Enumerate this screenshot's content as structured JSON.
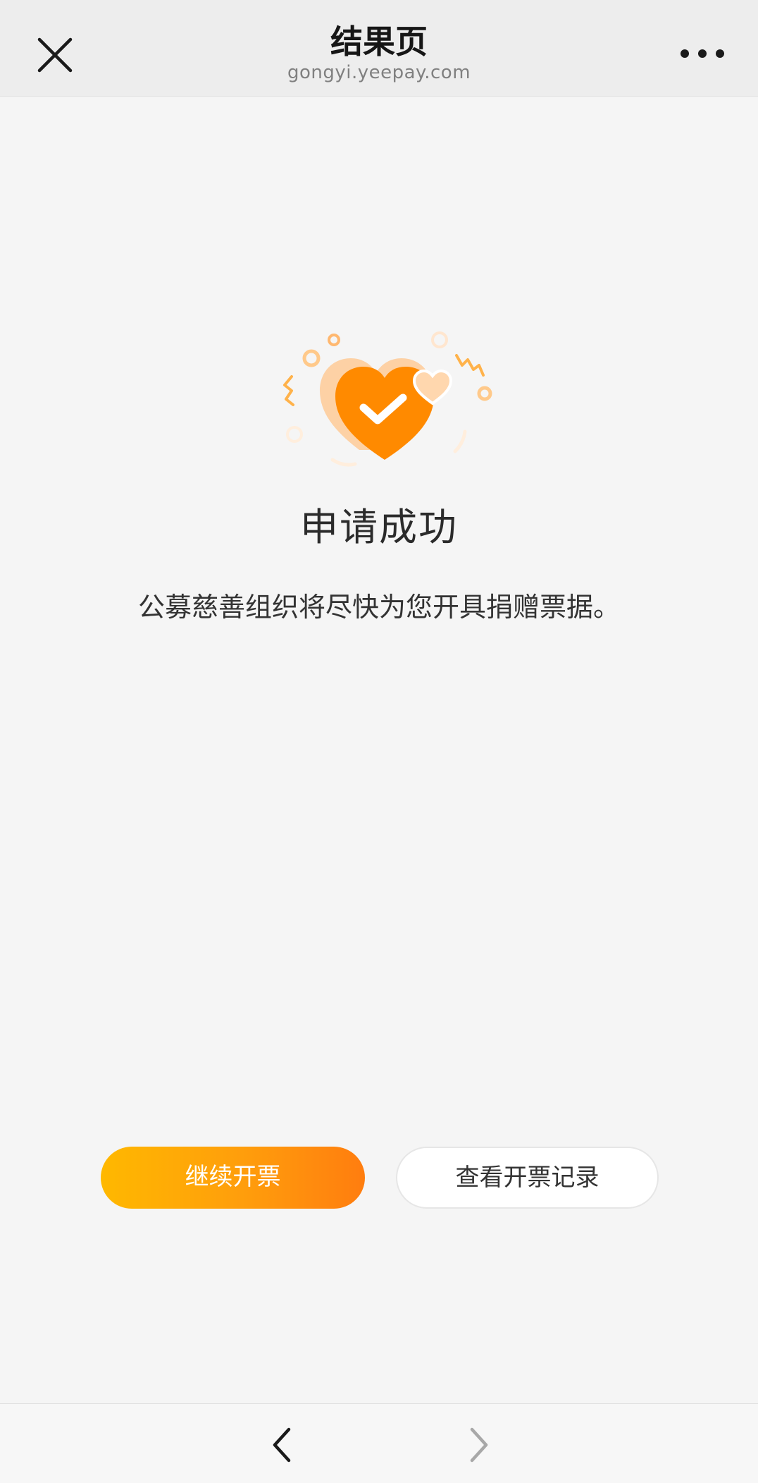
{
  "header": {
    "title": "结果页",
    "domain": "gongyi.yeepay.com",
    "close_icon": "close-icon",
    "more_icon": "more-icon"
  },
  "result": {
    "status": "success",
    "illustration_icon": "heart-check-icon",
    "title": "申请成功",
    "description": "公募慈善组织将尽快为您开具捐赠票据。"
  },
  "actions": {
    "continue_label": "继续开票",
    "records_label": "查看开票记录"
  },
  "bottom_nav": {
    "back_icon": "chevron-left-icon",
    "forward_icon": "chevron-right-icon",
    "forward_enabled": false
  },
  "colors": {
    "accent": "#ff8a00",
    "accent_start": "#ffb800",
    "accent_end": "#ff7d0f",
    "background": "#f5f5f5"
  }
}
